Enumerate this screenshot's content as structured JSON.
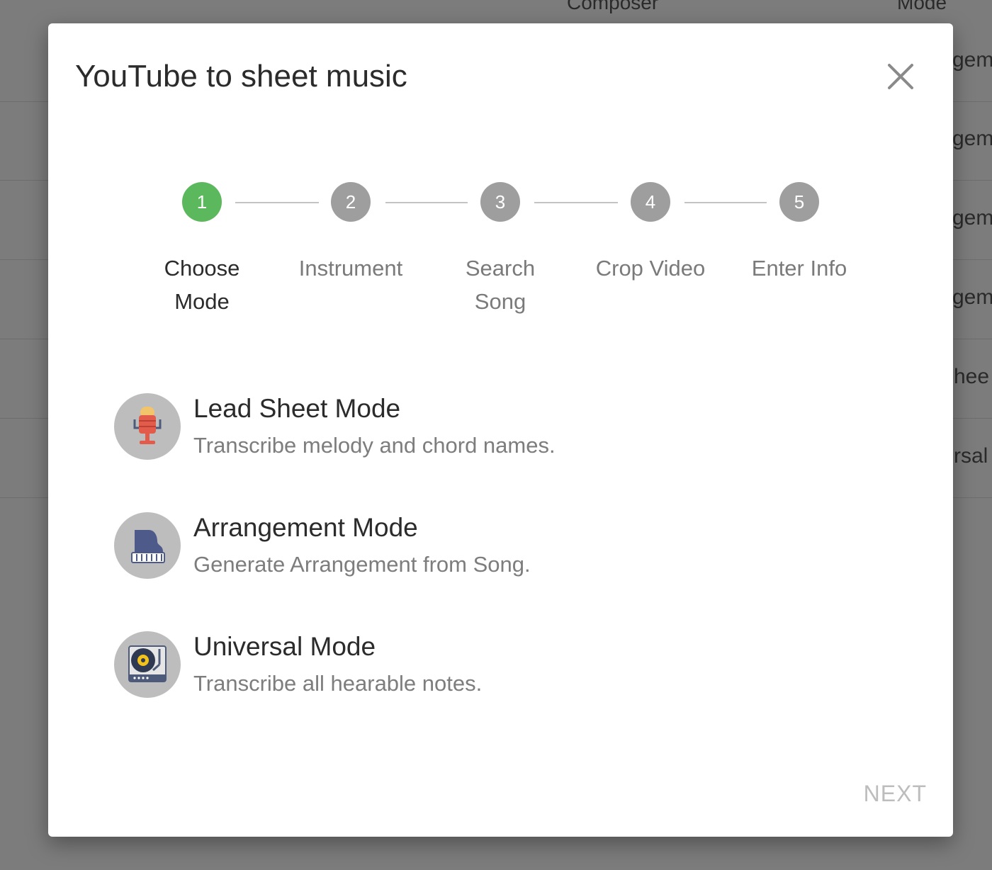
{
  "background": {
    "columns": [
      "Composer",
      "Mode"
    ],
    "rows": [
      {
        "mode": "gem"
      },
      {
        "mode": "gem"
      },
      {
        "mode": "gem"
      },
      {
        "mode": "gem"
      },
      {
        "mode": "hee"
      },
      {
        "mode": "rsal"
      }
    ]
  },
  "dialog": {
    "title": "YouTube to sheet music",
    "close_icon": "close-icon",
    "steps": [
      {
        "number": "1",
        "label_line1": "Choose",
        "label_line2": "Mode",
        "active": true
      },
      {
        "number": "2",
        "label_line1": "Instrument",
        "label_line2": "",
        "active": false
      },
      {
        "number": "3",
        "label_line1": "Search",
        "label_line2": "Song",
        "active": false
      },
      {
        "number": "4",
        "label_line1": "Crop Video",
        "label_line2": "",
        "active": false
      },
      {
        "number": "5",
        "label_line1": "Enter Info",
        "label_line2": "",
        "active": false
      }
    ],
    "modes": [
      {
        "title": "Lead Sheet Mode",
        "description": "Transcribe melody and chord names.",
        "icon": "microphone-icon"
      },
      {
        "title": "Arrangement Mode",
        "description": "Generate Arrangement from Song.",
        "icon": "piano-icon"
      },
      {
        "title": "Universal Mode",
        "description": "Transcribe all hearable notes.",
        "icon": "turntable-icon"
      }
    ],
    "next_label": "NEXT"
  },
  "colors": {
    "active_step": "#5cb85c",
    "inactive_step": "#9e9e9e",
    "overlay": "#7c7c7c"
  }
}
